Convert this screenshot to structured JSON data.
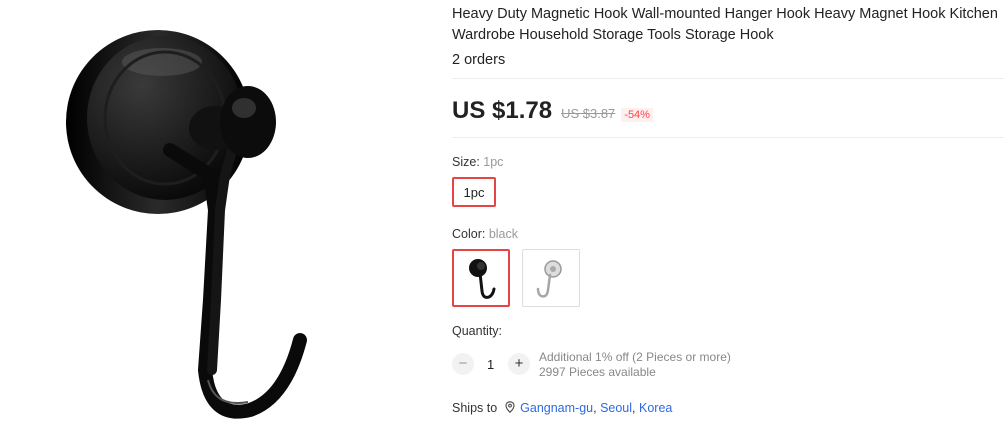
{
  "product": {
    "title_line1": "Heavy Duty Magnetic Hook Wall-mounted Hanger Hook Heavy Magnet Hook Kitchen",
    "title_line2": "Wardrobe Household Storage Tools Storage Hook",
    "orders": "2 orders"
  },
  "price": {
    "current": "US $1.78",
    "original": "US $3.87",
    "discount": "-54%"
  },
  "size": {
    "label": "Size:",
    "value": "1pc",
    "options": [
      "1pc"
    ]
  },
  "color": {
    "label": "Color:",
    "value": "black",
    "options": [
      {
        "name": "black-hook",
        "color": "#111111"
      },
      {
        "name": "silver-hook",
        "color": "#b9b9b9"
      }
    ]
  },
  "quantity": {
    "label": "Quantity:",
    "minus": "−",
    "value": "1",
    "plus": "+",
    "note_line1": "Additional 1% off (2 Pieces or more)",
    "note_line2": "2997 Pieces available"
  },
  "shipping": {
    "label": "Ships to",
    "loc1": "Gangnam-gu",
    "sep1": ", ",
    "loc2": "Seoul",
    "sep2": ", ",
    "loc3": "Korea"
  },
  "colors": {
    "accent": "#e64545",
    "link": "#2e6ae0",
    "discount": "#ff4444"
  }
}
